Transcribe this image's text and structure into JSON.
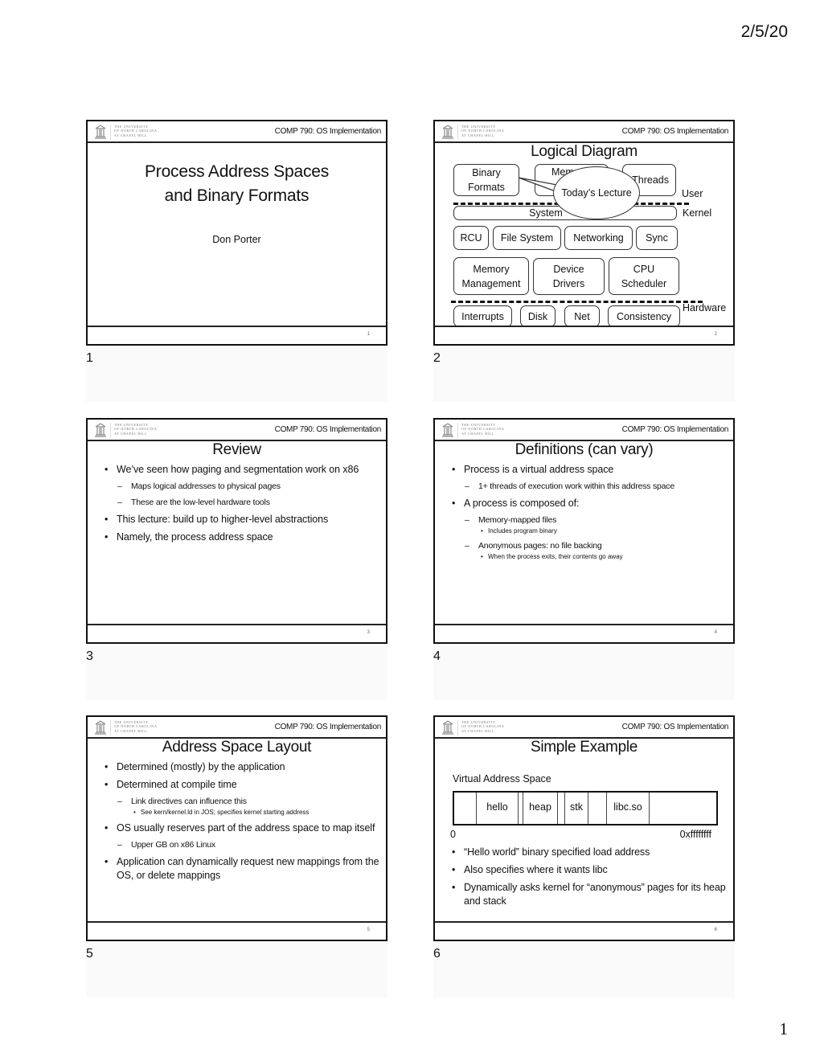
{
  "page": {
    "date": "2/5/20",
    "page_number": "1"
  },
  "header": {
    "logo_lines": [
      "The University",
      "of North Carolina",
      "at Chapel Hill"
    ],
    "course": "COMP 790: OS Implementation"
  },
  "slides": [
    {
      "index": "1",
      "footer_num": "1",
      "title_lines": [
        "Process Address Spaces",
        "and Binary Formats"
      ],
      "author": "Don Porter"
    },
    {
      "index": "2",
      "footer_num": "2",
      "title": "Logical Diagram",
      "boxes": {
        "binary_formats": "Binary Formats",
        "memory": "Mem",
        "threads": "Threads",
        "system_calls": "System",
        "rcu": "RCU",
        "file_system": "File System",
        "networking": "Networking",
        "sync": "Sync",
        "memory_management": "Memory Management",
        "device_drivers": "Device Drivers",
        "cpu_scheduler": "CPU Scheduler",
        "interrupts": "Interrupts",
        "disk": "Disk",
        "net": "Net",
        "consistency": "Consistency"
      },
      "callout": "Today’s Lecture",
      "layers": {
        "user": "User",
        "kernel": "Kernel",
        "hardware": "Hardware"
      }
    },
    {
      "index": "3",
      "footer_num": "3",
      "title": "Review",
      "bullets": [
        {
          "level": 1,
          "text": "We’ve seen how paging and segmentation work on x86"
        },
        {
          "level": 2,
          "text": "Maps logical addresses to physical pages"
        },
        {
          "level": 2,
          "text": "These are the low-level hardware tools"
        },
        {
          "level": 1,
          "text": "This lecture: build up to higher-level abstractions"
        },
        {
          "level": 1,
          "text": "Namely, the process address space"
        }
      ]
    },
    {
      "index": "4",
      "footer_num": "4",
      "title": "Definitions (can vary)",
      "bullets": [
        {
          "level": 1,
          "text": "Process is a virtual address space"
        },
        {
          "level": 2,
          "text": "1+ threads of execution work within this address space"
        },
        {
          "level": 1,
          "text": "A process is composed of:"
        },
        {
          "level": 2,
          "text": "Memory-mapped files"
        },
        {
          "level": 3,
          "text": "Includes program binary"
        },
        {
          "level": 2,
          "text": "Anonymous pages: no file backing"
        },
        {
          "level": 3,
          "text": "When the process exits, their contents go away"
        }
      ]
    },
    {
      "index": "5",
      "footer_num": "5",
      "title": "Address Space Layout",
      "bullets": [
        {
          "level": 1,
          "text": "Determined (mostly) by the application"
        },
        {
          "level": 1,
          "text": "Determined at compile time"
        },
        {
          "level": 2,
          "text": "Link directives can influence this"
        },
        {
          "level": 3,
          "text": "See kern/kernel.ld in JOS; specifies kernel starting address"
        },
        {
          "level": 1,
          "text": "OS usually reserves part of the address space to map itself"
        },
        {
          "level": 2,
          "text": "Upper GB on x86 Linux"
        },
        {
          "level": 1,
          "text": "Application can dynamically request new mappings from the OS, or delete mappings"
        }
      ]
    },
    {
      "index": "6",
      "footer_num": "6",
      "title": "Simple Example",
      "vas_label": "Virtual Address Space",
      "segments": [
        "",
        "hello",
        "",
        "heap",
        "",
        "stk",
        "",
        "libc.so",
        ""
      ],
      "addr_low": "0",
      "addr_high": "0xffffffff",
      "bullets": [
        {
          "level": 1,
          "text": "“Hello world” binary specified load address"
        },
        {
          "level": 1,
          "text": "Also specifies where it wants libc"
        },
        {
          "level": 1,
          "text": "Dynamically asks kernel for “anonymous” pages for its heap and stack"
        }
      ]
    }
  ]
}
